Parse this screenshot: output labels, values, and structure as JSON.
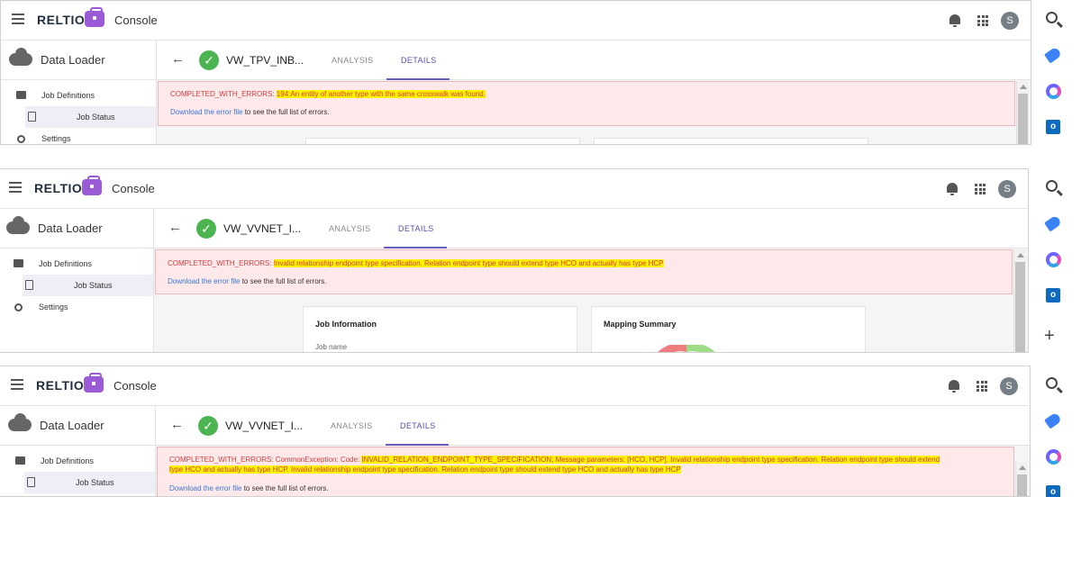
{
  "app": {
    "brand": "RELTIO",
    "console_label": "Console",
    "user_initial": "S"
  },
  "sidebar": {
    "section_title": "Data Loader",
    "items": [
      {
        "label": "Job Definitions"
      },
      {
        "label": "Job Status"
      },
      {
        "label": "Settings"
      }
    ]
  },
  "tabs": {
    "analysis": "ANALYSIS",
    "details": "DETAILS"
  },
  "download": {
    "link_text": "Download the error file",
    "suffix": " to see the full list of errors."
  },
  "rail_icons": [
    "search-icon",
    "tag-icon",
    "copilot-icon",
    "outlook-icon",
    "add-icon"
  ],
  "panels": [
    {
      "job_name": "VW_TPV_INB...",
      "error_prefix": "COMPLETED_WITH_ERRORS: ",
      "error_highlight": "194:An entity of another type with the same crosswalk was found.",
      "error_rest": ""
    },
    {
      "job_name": "VW_VVNET_I...",
      "error_prefix": "COMPLETED_WITH_ERRORS: ",
      "error_highlight": "Invalid relationship endpoint type specification. Relation endpoint type should extend type HCO and actually has type HCP",
      "error_rest": "",
      "cards": [
        {
          "title": "Job Information",
          "sub": "Job name"
        },
        {
          "title": "Mapping Summary"
        }
      ]
    },
    {
      "job_name": "VW_VVNET_I...",
      "error_prefix": "COMPLETED_WITH_ERRORS: CommonException: Code: ",
      "error_highlight": "INVALID_RELATION_ENDPOINT_TYPE_SPECIFICATION; Message parameters: [HCO, HCP]. Invalid relationship endpoint type specification. Relation endpoint type should extend",
      "error_line2": "type HCO and actually has type HCP. Invalid relationship endpoint type specification. Relation endpoint type should extend type HCO and actually has type HCP"
    }
  ],
  "colors": {
    "accent": "#6a5cc0",
    "success": "#4cb552",
    "error_text": "#d2403e",
    "error_bg": "#fde8ea",
    "highlight": "#fff200",
    "brand_purple": "#9b5ad6"
  }
}
